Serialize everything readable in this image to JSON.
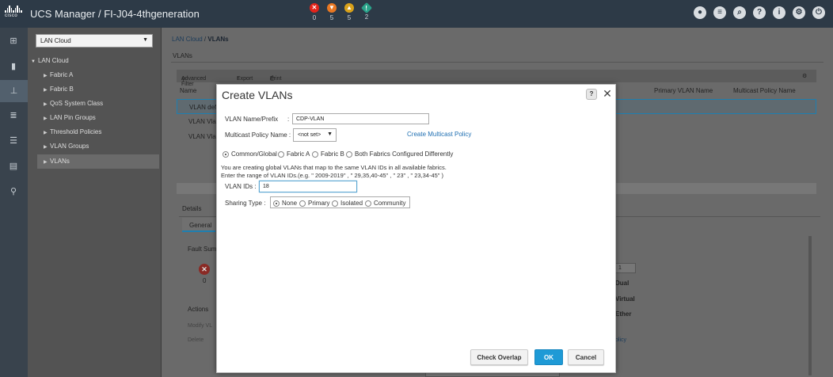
{
  "app": {
    "brand": "cisco",
    "title": "UCS Manager / FI-J04-4thgeneration"
  },
  "faults": [
    {
      "name": "critical",
      "count": "0",
      "color": "#e2231a",
      "glyph": "✕"
    },
    {
      "name": "major",
      "count": "5",
      "color": "#e87722",
      "glyph": "▼"
    },
    {
      "name": "minor",
      "count": "5",
      "color": "#d8a11a",
      "glyph": "▲"
    },
    {
      "name": "warning",
      "count": "2",
      "color": "#2aa38a",
      "glyph": "!"
    }
  ],
  "nav": {
    "selector_value": "LAN Cloud",
    "root": "LAN Cloud",
    "items": [
      {
        "label": "Fabric A"
      },
      {
        "label": "Fabric B"
      },
      {
        "label": "QoS System Class"
      },
      {
        "label": "LAN Pin Groups"
      },
      {
        "label": "Threshold Policies"
      },
      {
        "label": "VLAN Groups"
      },
      {
        "label": "VLANs"
      }
    ]
  },
  "main": {
    "breadcrumb_link": "LAN Cloud",
    "breadcrumb_sep": "/",
    "breadcrumb_current": "VLANs",
    "section_title": "VLANs",
    "toolbar": {
      "advanced_filter": "Advanced Filter",
      "export": "Export",
      "print": "Print"
    },
    "table": {
      "col_name": "Name",
      "col_primary_vlan": "Primary VLAN Name",
      "col_multicast": "Multicast Policy Name",
      "rows": [
        "VLAN def",
        "VLAN Vlan",
        "VLAN Vlan"
      ]
    },
    "details": {
      "title": "Details",
      "tab_general": "General",
      "fault_summary": "Fault Sum",
      "fault_count": "0",
      "actions_title": "Actions",
      "action_modify": "Modify VL",
      "action_delete": "Delete",
      "prop_value": "1",
      "prop_dual": "Dual",
      "prop_virtual": "Virtual",
      "prop_ether": "Ether",
      "prop_link": "olicy"
    }
  },
  "modal": {
    "title": "Create VLANs",
    "help": "?",
    "name_label": "VLAN Name/Prefix",
    "colon": ":",
    "name_value": "CDP-VLAN",
    "multicast_label": "Multicast Policy Name :",
    "multicast_value": "<not set>",
    "create_multicast_link": "Create Multicast Policy",
    "fabric_options": [
      {
        "label": "Common/Global",
        "selected": true
      },
      {
        "label": "Fabric A",
        "selected": false
      },
      {
        "label": "Fabric B",
        "selected": false
      },
      {
        "label": "Both Fabrics Configured Differently",
        "selected": false
      }
    ],
    "info_line1": "You are creating global VLANs that map to the same VLAN IDs in all available fabrics.",
    "info_line2": "Enter the range of VLAN IDs.(e.g. \" 2009-2019\" , \" 29,35,40-45\" , \" 23\" , \" 23,34-45\" )",
    "vlan_ids_label": "VLAN IDs :",
    "vlan_ids_value": "18",
    "sharing_label": "Sharing Type  :",
    "sharing_options": [
      {
        "label": "None",
        "selected": true
      },
      {
        "label": "Primary",
        "selected": false
      },
      {
        "label": "Isolated",
        "selected": false
      },
      {
        "label": "Community",
        "selected": false
      }
    ],
    "btn_check_overlap": "Check Overlap",
    "btn_ok": "OK",
    "btn_cancel": "Cancel"
  },
  "colors": {
    "topbar": "#2d3a47",
    "accent": "#1e9ad6",
    "link": "#1f6fb2"
  }
}
